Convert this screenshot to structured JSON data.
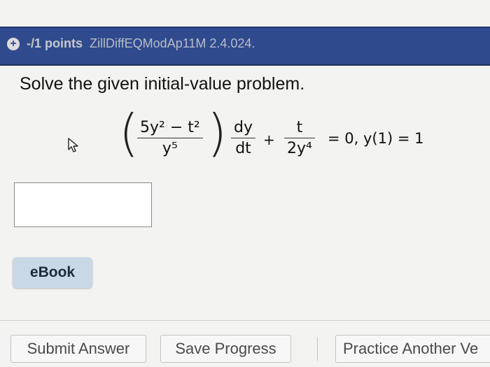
{
  "header": {
    "points": "-/1 points",
    "problem_id": "ZillDiffEQModAp11M 2.4.024."
  },
  "prompt": "Solve the given initial-value problem.",
  "equation": {
    "frac1_num": "5y² − t²",
    "frac1_den": "y⁵",
    "frac2_num": "dy",
    "frac2_den": "dt",
    "op": "+",
    "frac3_num": "t",
    "frac3_den": "2y⁴",
    "rhs": "= 0,   y(1) = 1"
  },
  "answer": {
    "value": "",
    "placeholder": ""
  },
  "ebook_label": "eBook",
  "footer": {
    "submit_label": "Submit Answer",
    "save_label": "Save Progress",
    "practice_label": "Practice Another Ve"
  },
  "colors": {
    "header_bg": "#2f4b8e",
    "ebook_bg": "#c9d8e6"
  }
}
